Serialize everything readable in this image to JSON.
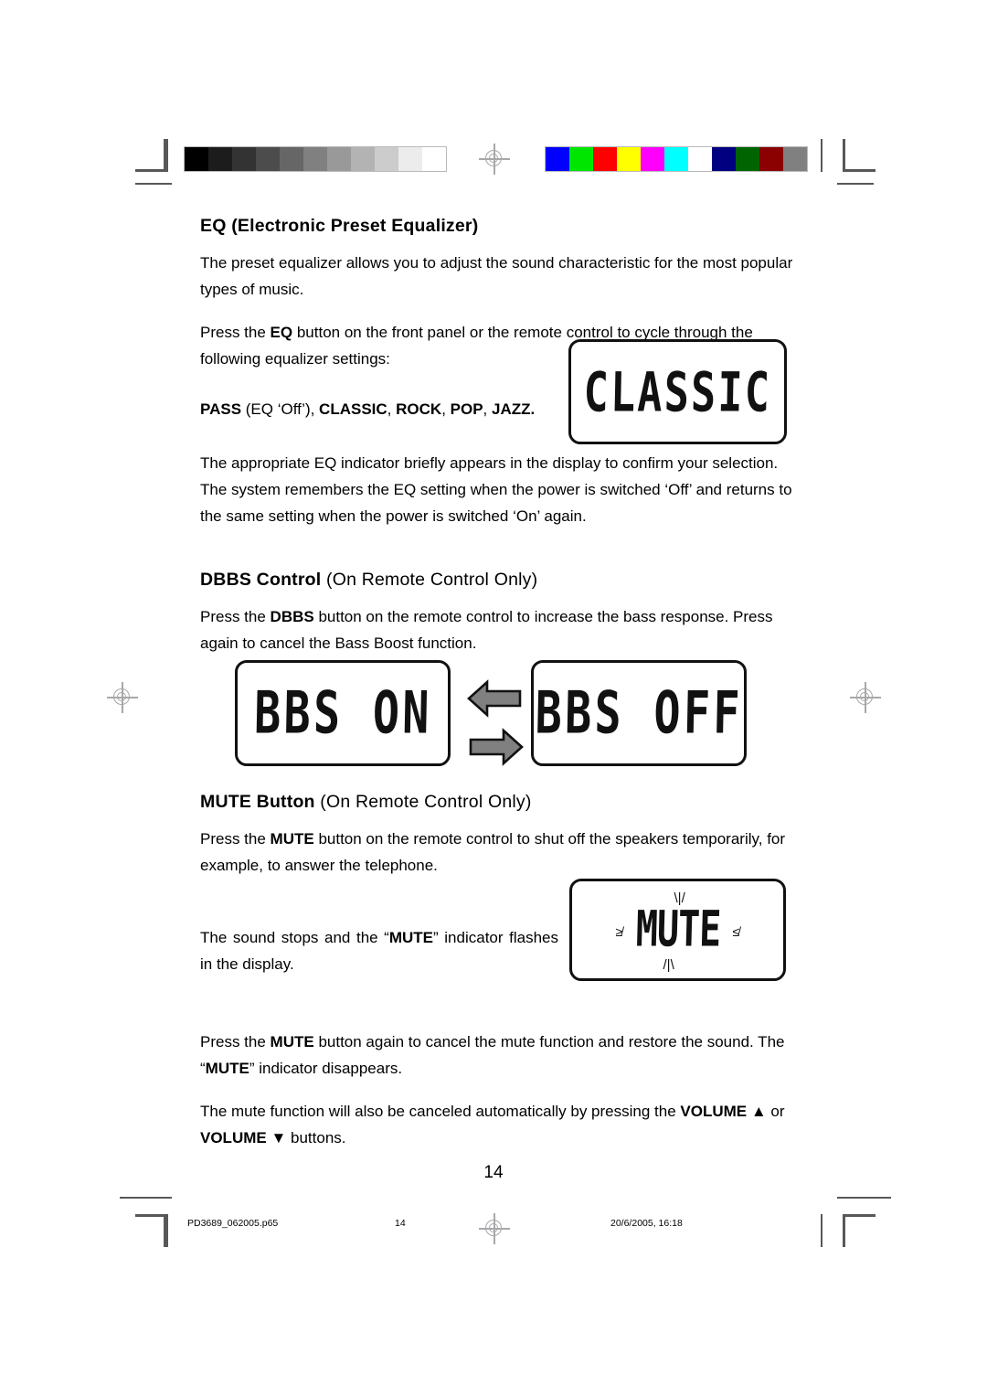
{
  "page": {
    "number": "14",
    "footer": {
      "file_name": "PD3689_062005.p65",
      "page_label": "14",
      "timestamp": "20/6/2005, 16:18"
    }
  },
  "calibration": {
    "grayscale_label": "grayscale-calibration-bar",
    "grayscale_swatches": [
      "#000000",
      "#1c1c1c",
      "#333333",
      "#4c4c4c",
      "#666666",
      "#808080",
      "#999999",
      "#b3b3b3",
      "#cccccc",
      "#ececec",
      "#ffffff"
    ],
    "color_label": "color-calibration-bar",
    "color_swatches": [
      "#0000ff",
      "#00e600",
      "#fe0000",
      "#ffff00",
      "#ff00ff",
      "#00ffff",
      "#ffffff",
      "#000080",
      "#006400",
      "#8b0000",
      "#808080"
    ]
  },
  "sections": [
    {
      "id": "eq",
      "heading_bold": "EQ (Electronic Preset Equalizer)",
      "heading_regular": "",
      "paragraphs": [
        {
          "id": "eq-intro",
          "runs": [
            {
              "t": "The preset equalizer allows you to adjust the sound characteristic for the most popular types of music.",
              "b": false
            }
          ]
        },
        {
          "id": "eq-press",
          "runs": [
            {
              "t": "Press the ",
              "b": false
            },
            {
              "t": "EQ",
              "b": true
            },
            {
              "t": " button on the front panel or the remote control to cycle through the following equalizer settings:",
              "b": false
            }
          ]
        },
        {
          "id": "eq-settings-list",
          "runs": [
            {
              "t": "PASS",
              "b": true
            },
            {
              "t": " (EQ ‘Off’), ",
              "b": false
            },
            {
              "t": "CLASSIC",
              "b": true
            },
            {
              "t": ", ",
              "b": false
            },
            {
              "t": "ROCK",
              "b": true
            },
            {
              "t": ", ",
              "b": false
            },
            {
              "t": "POP",
              "b": true
            },
            {
              "t": ", ",
              "b": false
            },
            {
              "t": "JAZZ.",
              "b": true
            }
          ]
        },
        {
          "id": "eq-indicator",
          "runs": [
            {
              "t": "The appropriate EQ indicator briefly appears in the display to confirm your selection. The system remembers the EQ setting when the power is switched ‘Off’ and returns to the same setting when the power is switched ‘On’ again.",
              "b": false
            }
          ]
        }
      ]
    },
    {
      "id": "dbbs",
      "heading_bold": "DBBS Control",
      "heading_regular": " (On Remote Control Only)",
      "paragraphs": [
        {
          "id": "dbbs-press",
          "runs": [
            {
              "t": "Press the ",
              "b": false
            },
            {
              "t": "DBBS",
              "b": true
            },
            {
              "t": " button on the remote control to increase the bass response. Press again to cancel the Bass Boost function.",
              "b": false
            }
          ]
        }
      ]
    },
    {
      "id": "mute",
      "heading_bold": "MUTE Button",
      "heading_regular": " (On Remote Control Only)",
      "paragraphs": [
        {
          "id": "mute-press",
          "runs": [
            {
              "t": "Press the ",
              "b": false
            },
            {
              "t": "MUTE",
              "b": true
            },
            {
              "t": " button on the remote control to shut off the speakers temporarily, for example, to answer the telephone.",
              "b": false
            }
          ]
        },
        {
          "id": "mute-flash",
          "runs": [
            {
              "t": "The sound stops and the “",
              "b": false
            },
            {
              "t": "MUTE",
              "b": true
            },
            {
              "t": "” indicator flashes in the display.",
              "b": false
            }
          ]
        },
        {
          "id": "mute-cancel",
          "runs": [
            {
              "t": "Press the ",
              "b": false
            },
            {
              "t": "MUTE",
              "b": true
            },
            {
              "t": " button again to cancel the mute function and restore the sound. The “",
              "b": false
            },
            {
              "t": "MUTE",
              "b": true
            },
            {
              "t": "” indicator disappears.",
              "b": false
            }
          ]
        },
        {
          "id": "mute-volume",
          "runs": [
            {
              "t": "The mute function will also be canceled automatically by pressing the ",
              "b": false
            },
            {
              "t": "VOLUME ▲",
              "b": true
            },
            {
              "t": " or ",
              "b": false
            },
            {
              "t": "VOLUME ▼",
              "b": true
            },
            {
              "t": " buttons.",
              "b": false
            }
          ]
        }
      ]
    }
  ],
  "displays": {
    "classic": {
      "text": "CLASSIC",
      "caption": "eq-classic-lcd"
    },
    "bbs_on": {
      "text": "BBS ON",
      "caption": "bbs-on-lcd"
    },
    "bbs_off": {
      "text": "BBS OFF",
      "caption": "bbs-off-lcd"
    },
    "mute": {
      "text": "MUTE",
      "caption": "mute-lcd",
      "flash_top": "\\|/",
      "flash_bottom": "/|\\",
      "flash_left": "≱",
      "flash_right": "≰"
    }
  },
  "arrows": {
    "left_label": "toggle-arrow-left",
    "right_label": "toggle-arrow-right",
    "fill": "#808080",
    "stroke": "#111111"
  }
}
